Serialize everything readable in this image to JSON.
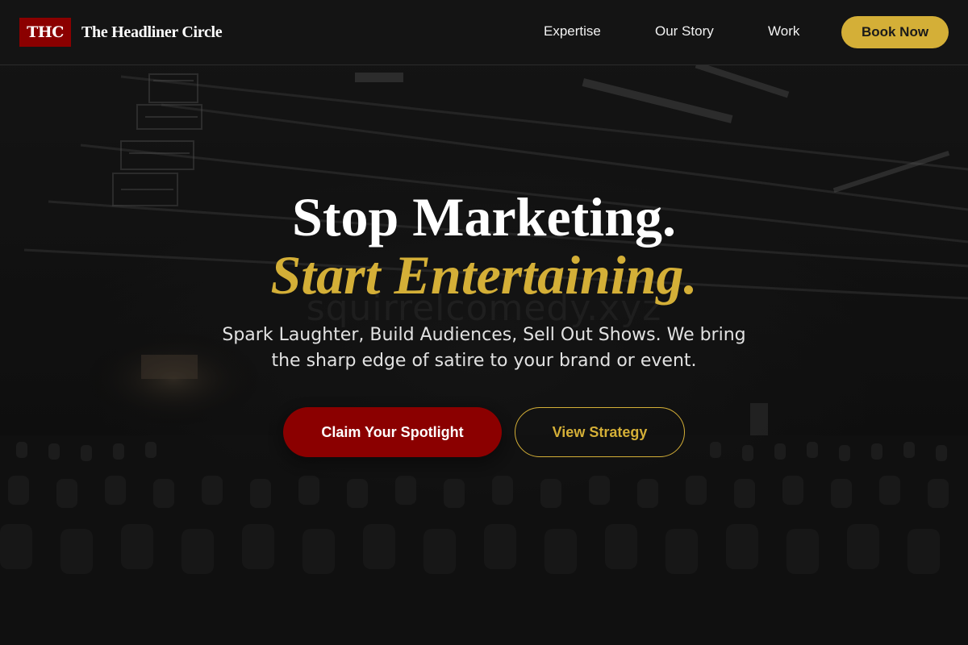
{
  "nav": {
    "logo_badge": "THC",
    "brand_name": "The Headliner Circle",
    "links": [
      {
        "label": "Expertise"
      },
      {
        "label": "Our Story"
      },
      {
        "label": "Work"
      }
    ],
    "cta_label": "Book Now"
  },
  "hero": {
    "title_line_1": "Stop Marketing.",
    "title_line_2": "Start Entertaining.",
    "watermark": "squirrelcomedy.xyz",
    "subtitle": "Spark Laughter, Build Audiences, Sell Out Shows. We bring the sharp edge of satire to your brand or event.",
    "primary_cta": "Claim Your Spotlight",
    "secondary_cta": "View Strategy"
  },
  "colors": {
    "accent_gold": "#d4af37",
    "brand_red": "#8b0000",
    "background": "#121212"
  }
}
